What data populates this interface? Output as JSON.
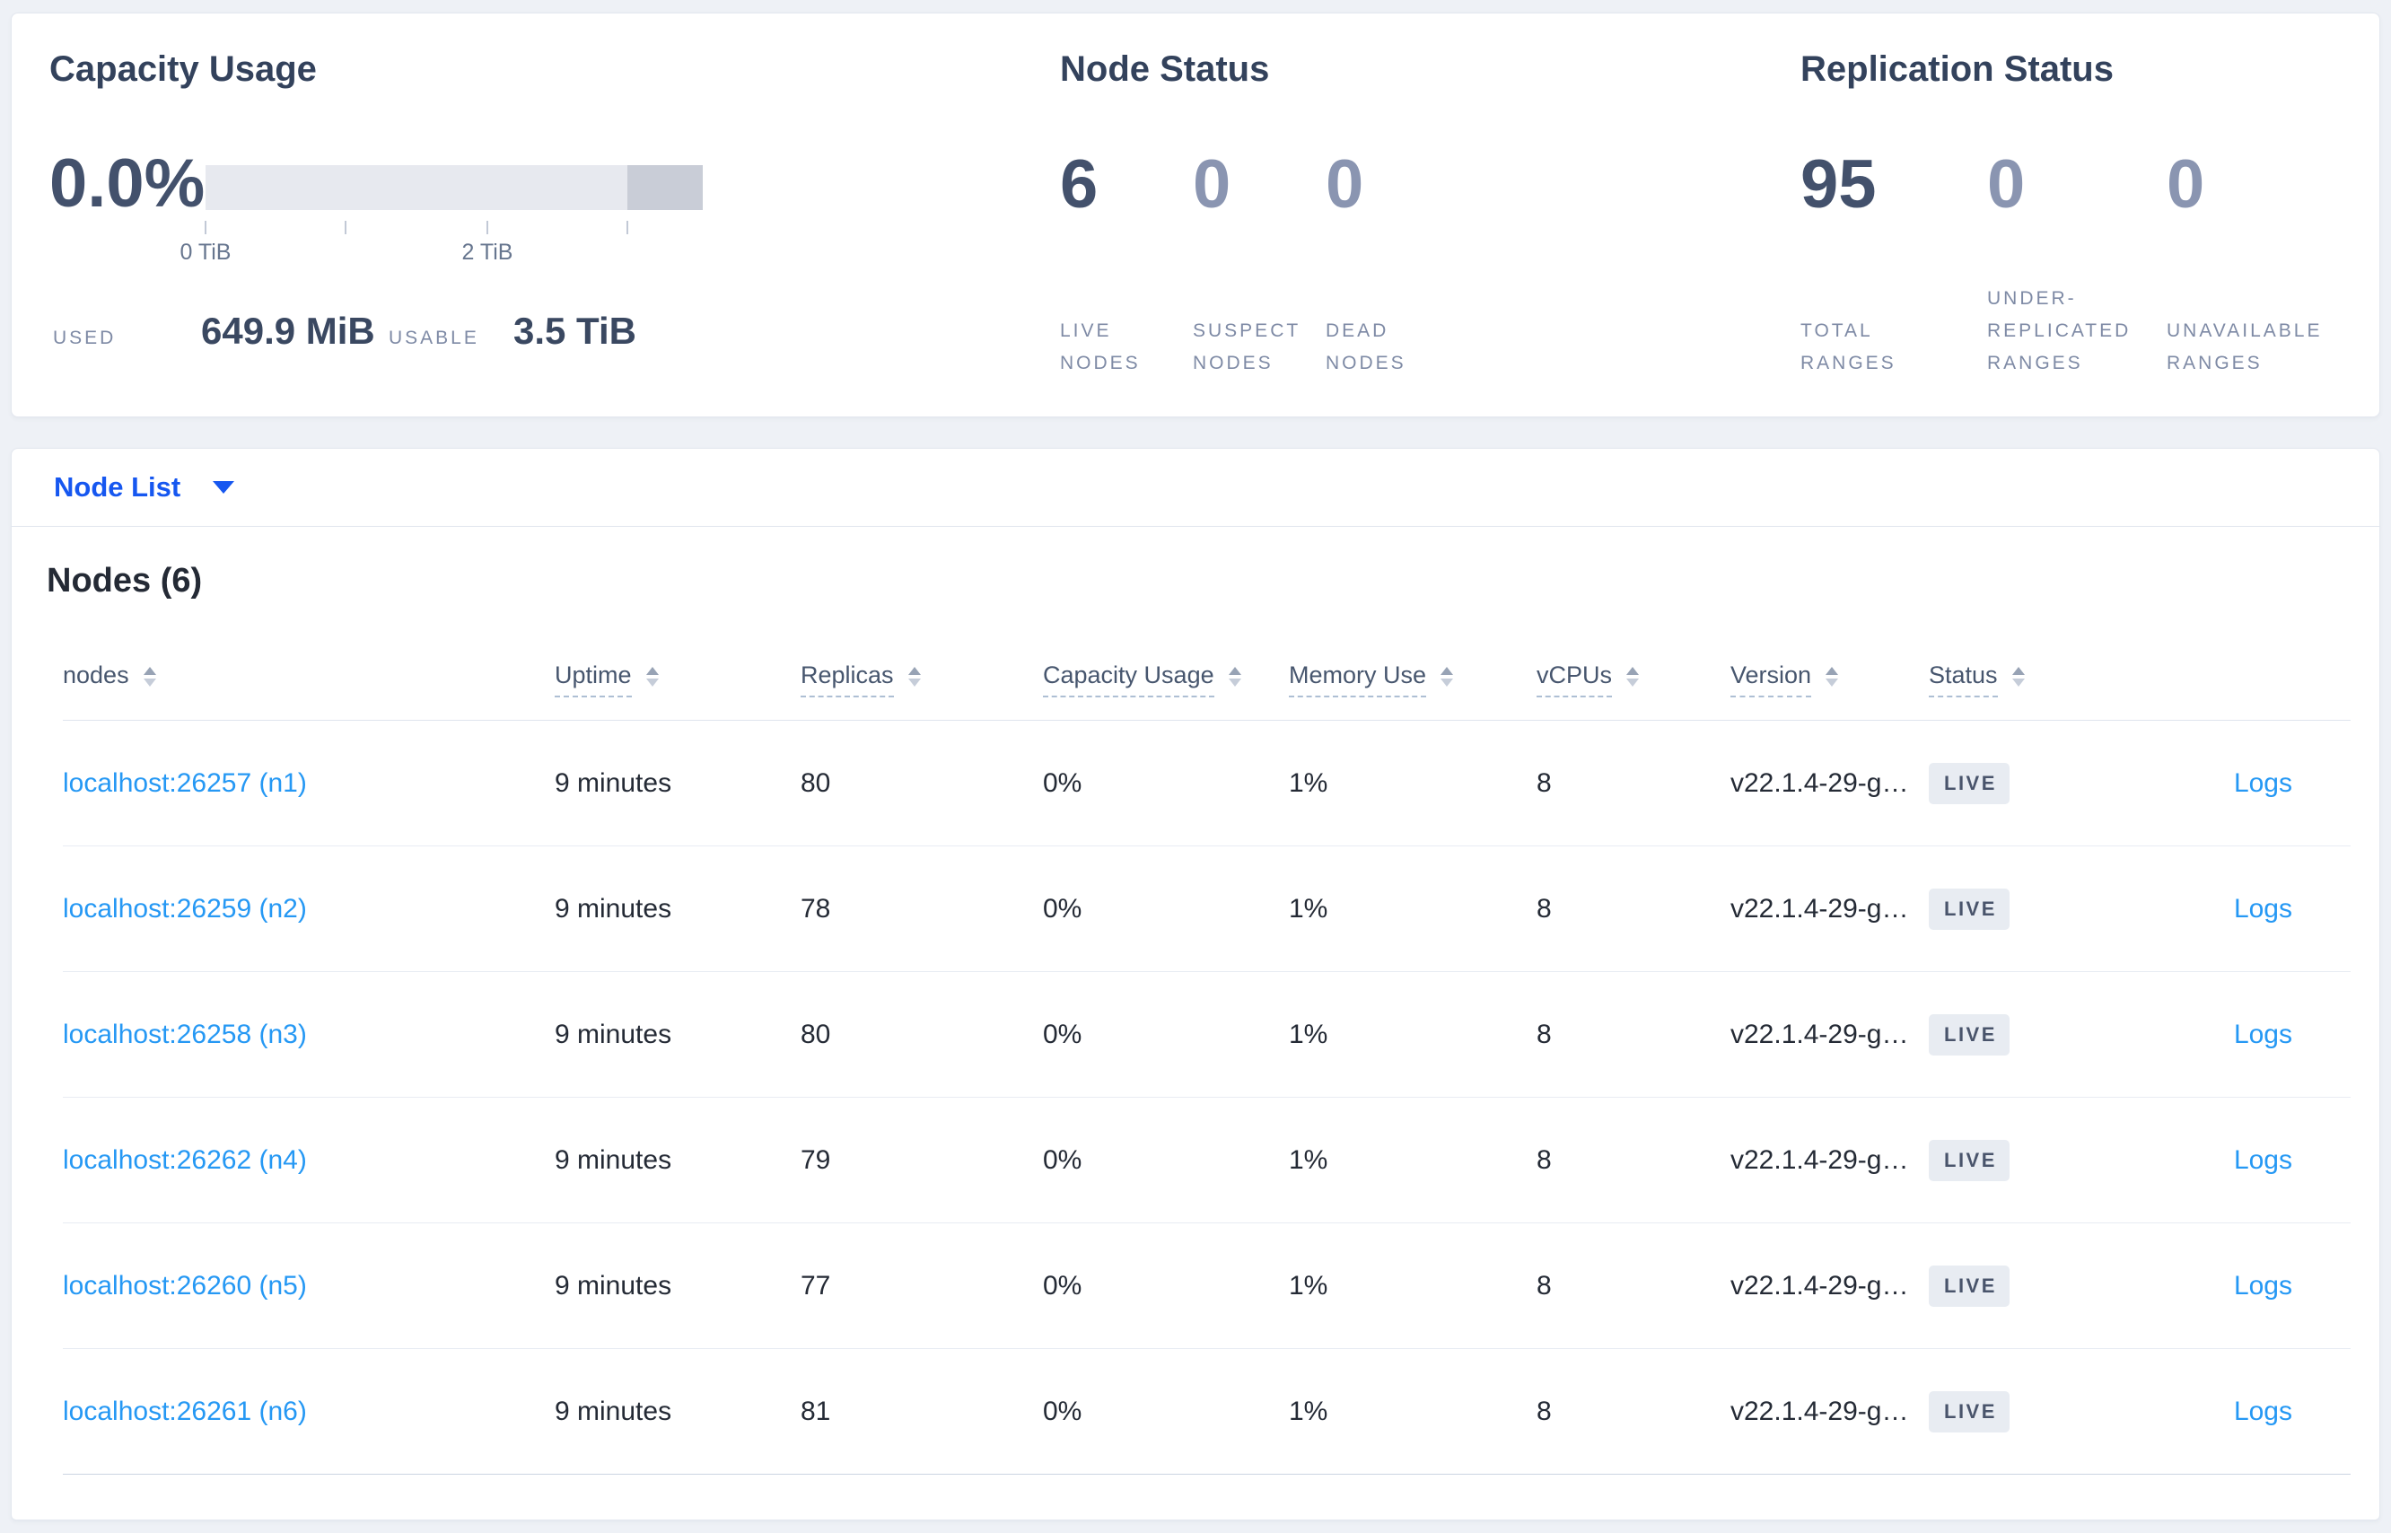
{
  "colors": {
    "accent_blue": "#1657f0",
    "link_blue": "#2598f4",
    "badge_bg": "#e8ecf2",
    "badge_text": "#49546b",
    "bar_light": "#e7e9ef",
    "bar_dark": "#c9cdd7"
  },
  "summary": {
    "capacity": {
      "title": "Capacity Usage",
      "percent": "0.0%",
      "axis_tick_labels": [
        "0 TiB",
        "2 TiB"
      ],
      "used_label": "USED",
      "used_value": "649.9 MiB",
      "usable_label": "USABLE",
      "usable_value": "3.5 TiB"
    },
    "node_status": {
      "title": "Node Status",
      "stats": [
        {
          "value": "6",
          "label": "LIVE\nNODES"
        },
        {
          "value": "0",
          "label": "SUSPECT\nNODES"
        },
        {
          "value": "0",
          "label": "DEAD\nNODES"
        }
      ]
    },
    "replication_status": {
      "title": "Replication Status",
      "stats": [
        {
          "value": "95",
          "label": "TOTAL\nRANGES"
        },
        {
          "value": "0",
          "label": "UNDER-\nREPLICATED\nRANGES"
        },
        {
          "value": "0",
          "label": "UNAVAILABLE\nRANGES"
        }
      ]
    }
  },
  "view_selector": {
    "label": "Node List"
  },
  "nodes_panel": {
    "heading": "Nodes (6)",
    "columns": [
      {
        "label": "nodes"
      },
      {
        "label": "Uptime"
      },
      {
        "label": "Replicas"
      },
      {
        "label": "Capacity Usage"
      },
      {
        "label": "Memory Use"
      },
      {
        "label": "vCPUs"
      },
      {
        "label": "Version"
      },
      {
        "label": "Status"
      }
    ],
    "logs_label": "Logs",
    "rows": [
      {
        "address": "localhost:26257 (n1)",
        "uptime": "9 minutes",
        "replicas": "80",
        "capacity_usage": "0%",
        "memory_use": "1%",
        "vcpus": "8",
        "version": "v22.1.4-29-g…",
        "status": "LIVE"
      },
      {
        "address": "localhost:26259 (n2)",
        "uptime": "9 minutes",
        "replicas": "78",
        "capacity_usage": "0%",
        "memory_use": "1%",
        "vcpus": "8",
        "version": "v22.1.4-29-g…",
        "status": "LIVE"
      },
      {
        "address": "localhost:26258 (n3)",
        "uptime": "9 minutes",
        "replicas": "80",
        "capacity_usage": "0%",
        "memory_use": "1%",
        "vcpus": "8",
        "version": "v22.1.4-29-g…",
        "status": "LIVE"
      },
      {
        "address": "localhost:26262 (n4)",
        "uptime": "9 minutes",
        "replicas": "79",
        "capacity_usage": "0%",
        "memory_use": "1%",
        "vcpus": "8",
        "version": "v22.1.4-29-g…",
        "status": "LIVE"
      },
      {
        "address": "localhost:26260 (n5)",
        "uptime": "9 minutes",
        "replicas": "77",
        "capacity_usage": "0%",
        "memory_use": "1%",
        "vcpus": "8",
        "version": "v22.1.4-29-g…",
        "status": "LIVE"
      },
      {
        "address": "localhost:26261 (n6)",
        "uptime": "9 minutes",
        "replicas": "81",
        "capacity_usage": "0%",
        "memory_use": "1%",
        "vcpus": "8",
        "version": "v22.1.4-29-g…",
        "status": "LIVE"
      }
    ]
  }
}
